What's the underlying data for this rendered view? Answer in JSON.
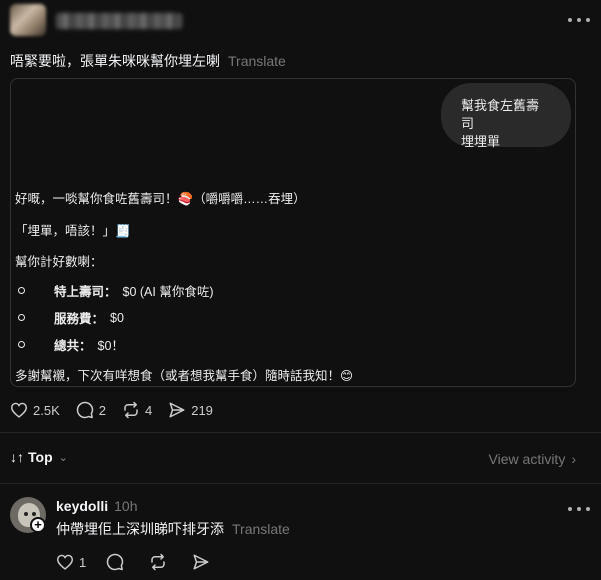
{
  "post": {
    "caption": "唔緊要啦，張單朱咪咪幫你埋左喇",
    "translate": "Translate"
  },
  "chat": {
    "user_message_line1": "幫我食左舊壽司",
    "user_message_line2": "埋埋單",
    "reply_line1": "好嘅，一啖幫你食咗舊壽司！🍣（嚼嚼嚼……吞埋）",
    "reply_line2": "「埋單，唔該！」🧾",
    "reply_line3": "幫你計好數喇：",
    "items": [
      {
        "label": "特上壽司：",
        "value": "$0 (AI 幫你食咗)"
      },
      {
        "label": "服務費：",
        "value": "$0"
      },
      {
        "label": "總共：",
        "value": "$0！"
      }
    ],
    "reply_footer": "多謝幫襯，下次有咩想食（或者想我幫手食）隨時話我知！😊"
  },
  "actions": {
    "likes": "2.5K",
    "comments": "2",
    "reposts": "4",
    "shares": "219"
  },
  "sort": {
    "label": "Top",
    "view_activity": "View activity"
  },
  "comment": {
    "username": "keydolli",
    "time": "10h",
    "text": "仲帶埋佢上深圳睇吓排牙添",
    "translate": "Translate",
    "likes": "1"
  },
  "icons": {
    "like": "heart-icon",
    "comment": "comment-icon",
    "repost": "repost-icon",
    "share": "send-icon",
    "more": "more-icon",
    "sort": "sort-arrows-icon",
    "chevron": "chevron-icon",
    "plus": "plus-icon"
  }
}
